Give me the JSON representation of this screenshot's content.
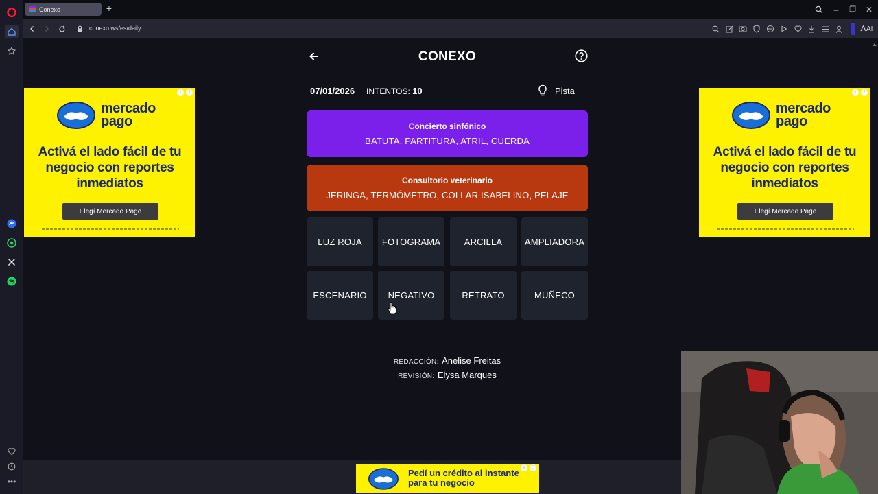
{
  "browser": {
    "tab_title": "Conexo",
    "url": "conexo.ws/es/daily",
    "ai_label": "AI"
  },
  "game": {
    "title": "CONEXO",
    "date": "07/01/2026",
    "attempts_label": "INTENTOS:",
    "attempts_value": "10",
    "hint_label": "Pista",
    "groups": [
      {
        "title": "Concierto sinfónico",
        "words": "BATUTA, PARTITURA, ATRIL, CUERDA",
        "color": "#7b1fea"
      },
      {
        "title": "Consultorio veterinario",
        "words": "JERINGA, TERMÓMETRO, COLLAR ISABELINO, PELAJE",
        "color": "#b8380f"
      }
    ],
    "tiles": [
      "LUZ ROJA",
      "FOTOGRAMA",
      "ARCILLA",
      "AMPLIADORA",
      "ESCENARIO",
      "NEGATIVO",
      "RETRATO",
      "MUÑECO"
    ],
    "credits": {
      "editor_label": "REDACCIÓN:",
      "editor_name": "Anelise Freitas",
      "reviewer_label": "REVISIÓN:",
      "reviewer_name": "Elysa Marques"
    }
  },
  "ads": {
    "brand_line1": "mercado",
    "brand_line2": "pago",
    "headline": "Activá el lado fácil de tu negocio con reportes inmediatos",
    "button": "Elegí Mercado Pago",
    "bottom_line1": "Pedí un crédito al instante",
    "bottom_line2": "para tu negocio",
    "brand_color": "#1a2a6c",
    "background": "#fff200"
  }
}
